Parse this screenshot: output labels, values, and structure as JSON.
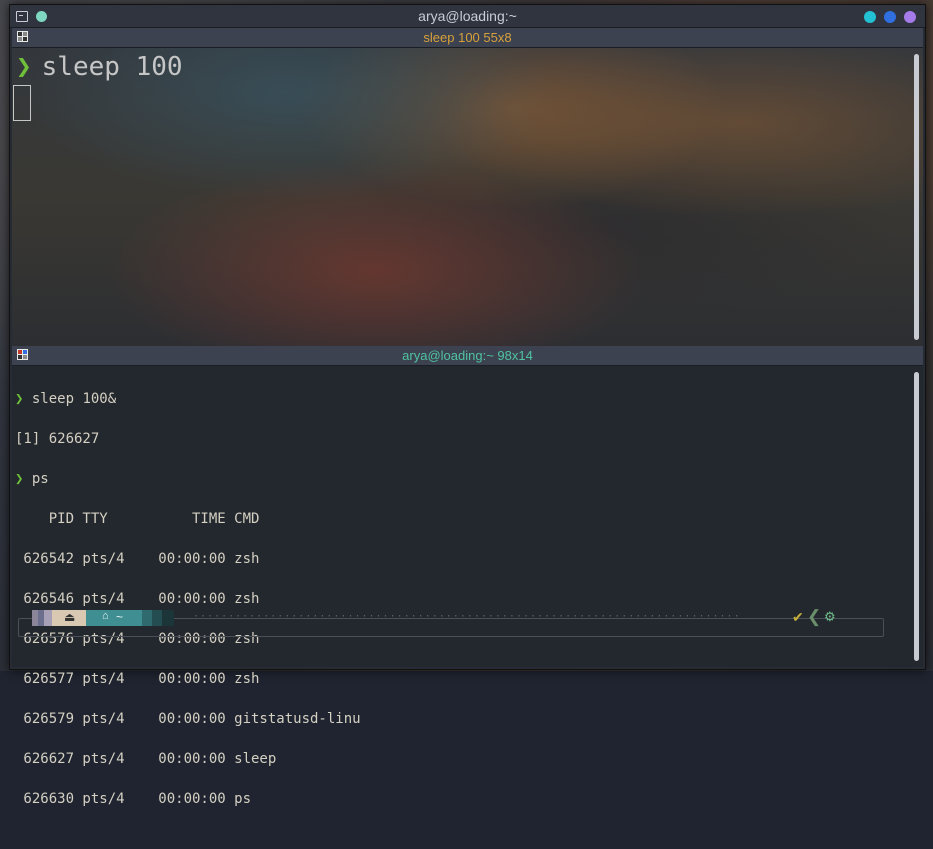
{
  "window": {
    "title": "arya@loading:~"
  },
  "top_pane": {
    "header": "sleep 100 55x8",
    "prompt_symbol": "❯",
    "command": "sleep 100"
  },
  "bottom_pane": {
    "header": "arya@loading:~ 98x14",
    "lines": [
      {
        "prompt": "❯",
        "text": " sleep 100&"
      },
      {
        "prompt": "",
        "text": "[1] 626627"
      },
      {
        "prompt": "❯",
        "text": " ps"
      },
      {
        "prompt": "",
        "text": "    PID TTY          TIME CMD"
      },
      {
        "prompt": "",
        "text": " 626542 pts/4    00:00:00 zsh"
      },
      {
        "prompt": "",
        "text": " 626546 pts/4    00:00:00 zsh"
      },
      {
        "prompt": "",
        "text": " 626576 pts/4    00:00:00 zsh"
      },
      {
        "prompt": "",
        "text": " 626577 pts/4    00:00:00 zsh"
      },
      {
        "prompt": "",
        "text": " 626579 pts/4    00:00:00 gitstatusd-linu"
      },
      {
        "prompt": "",
        "text": " 626627 pts/4    00:00:00 sleep"
      },
      {
        "prompt": "",
        "text": " 626630 pts/4    00:00:00 ps"
      }
    ],
    "statusline": {
      "dir_icon": "home-icon",
      "dir": "~",
      "status_check": "✔",
      "chevron": "❮",
      "gear": "⚙"
    }
  },
  "colors": {
    "prompt_green": "#6fbf3a",
    "top_header_text": "#d7a13a",
    "bottom_header_text": "#4fc3a1",
    "min_button": "#22c1d3",
    "max_button": "#2f6fe0",
    "close_button": "#a57be9"
  }
}
